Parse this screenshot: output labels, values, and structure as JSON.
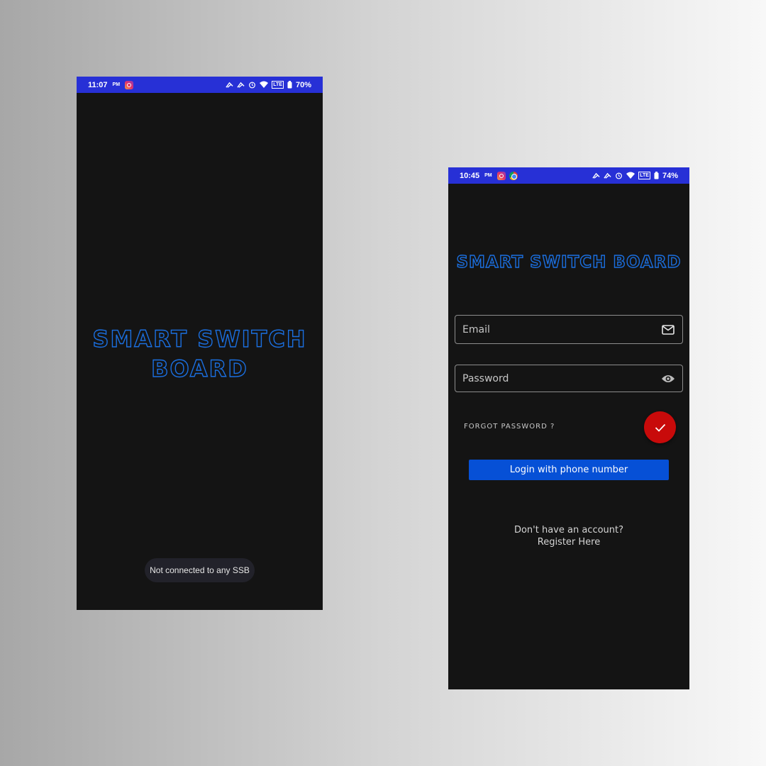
{
  "splash_screen": {
    "status_bar": {
      "time": "11:07",
      "ampm": "PM",
      "notification_icons": [
        "instagram-icon"
      ],
      "system_icons": [
        "cast-icon",
        "cast-icon",
        "alarm-icon",
        "wifi-icon",
        "lte-icon",
        "battery-icon"
      ],
      "lte_label": "LTE",
      "battery": "70%"
    },
    "logo_text": "SMART SWITCH BOARD",
    "toast": "Not connected to any SSB"
  },
  "login_screen": {
    "status_bar": {
      "time": "10:45",
      "ampm": "PM",
      "notification_icons": [
        "instagram-icon",
        "chrome-icon"
      ],
      "system_icons": [
        "cast-icon",
        "cast-icon",
        "alarm-icon",
        "wifi-icon",
        "lte-icon",
        "battery-icon"
      ],
      "lte_label": "LTE",
      "battery": "74%"
    },
    "logo_text": "SMART SWITCH BOARD",
    "email": {
      "placeholder": "Email",
      "value": "",
      "icon": "mail-icon"
    },
    "password": {
      "placeholder": "Password",
      "value": "",
      "icon": "eye-icon"
    },
    "forgot_password": "FORGOT PASSWORD ?",
    "submit_icon": "check-icon",
    "phone_login_button": "Login with phone number",
    "register_line1": "Don't have an account?",
    "register_line2": "Register Here"
  },
  "colors": {
    "status_bar": "#2730d6",
    "app_background": "#141414",
    "logo_stroke": "#1b6fe0",
    "fab": "#c80a0a",
    "primary_button": "#0650d6"
  }
}
